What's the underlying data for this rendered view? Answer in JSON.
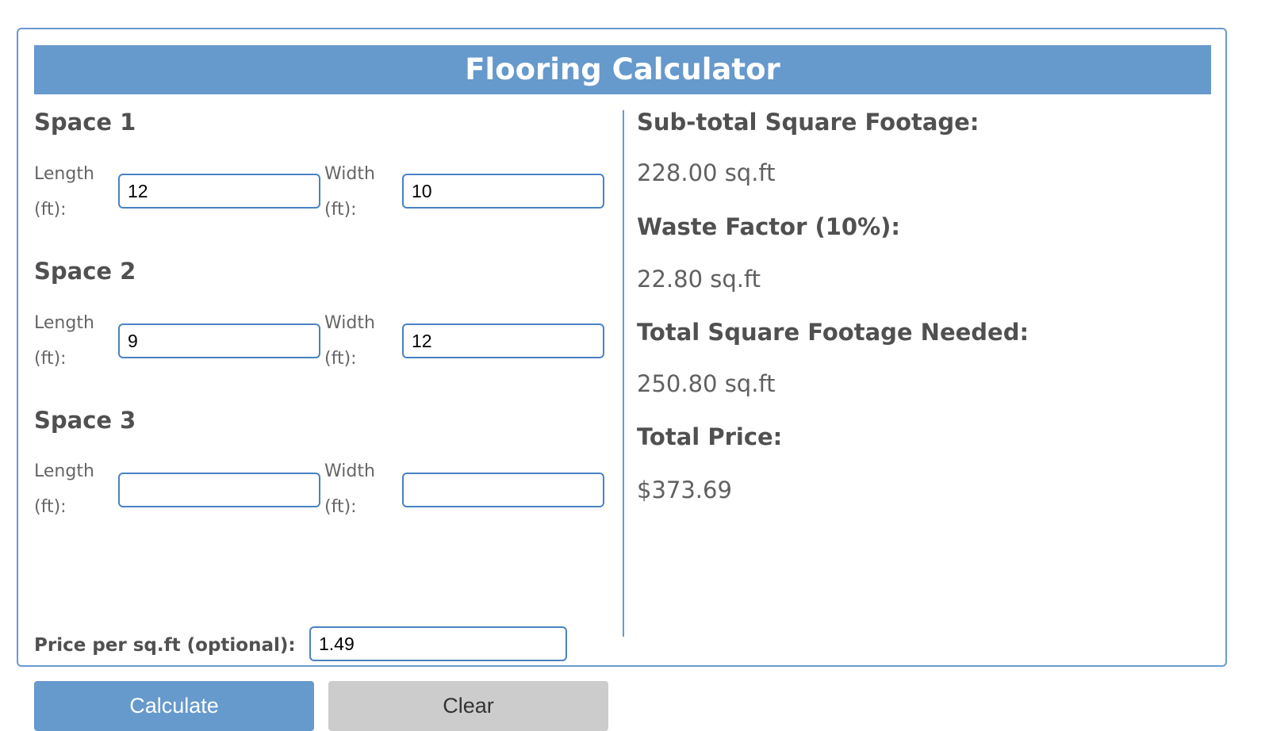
{
  "title": "Flooring Calculator",
  "spaces": [
    {
      "title": "Space 1",
      "length_label_line1": "Length",
      "length_label_line2": "(ft):",
      "length_value": "12",
      "width_label_line1": "Width",
      "width_label_line2": "(ft):",
      "width_value": "10"
    },
    {
      "title": "Space 2",
      "length_label_line1": "Length",
      "length_label_line2": "(ft):",
      "length_value": "9",
      "width_label_line1": "Width",
      "width_label_line2": "(ft):",
      "width_value": "12"
    },
    {
      "title": "Space 3",
      "length_label_line1": "Length",
      "length_label_line2": "(ft):",
      "length_value": "",
      "width_label_line1": "Width",
      "width_label_line2": "(ft):",
      "width_value": ""
    }
  ],
  "price": {
    "label": "Price per sq.ft (optional):",
    "value": "1.49"
  },
  "buttons": {
    "calculate": "Calculate",
    "clear": "Clear"
  },
  "results": {
    "subtotal_label": "Sub-total Square Footage:",
    "subtotal_value": "228.00 sq.ft",
    "waste_label": "Waste Factor (10%):",
    "waste_value": "22.80 sq.ft",
    "total_label": "Total Square Footage Needed:",
    "total_value": "250.80 sq.ft",
    "price_label": "Total Price:",
    "price_value": "$373.69"
  },
  "colors": {
    "accent": "#6699cc",
    "border": "#6b9ad0",
    "input_border": "#4a82c4",
    "clear_button": "#cccccc"
  }
}
